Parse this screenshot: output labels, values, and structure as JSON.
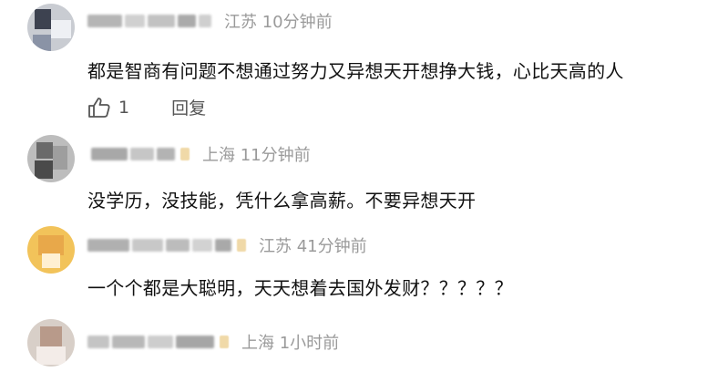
{
  "comments": [
    {
      "location_time": "江苏 10分钟前",
      "text": "都是智商有问题不想通过努力又异想天开想挣大钱，心比天高的人",
      "like_count": "1",
      "reply_label": "回复"
    },
    {
      "location_time": "上海 11分钟前",
      "text": "没学历，没技能，凭什么拿高薪。不要异想天开"
    },
    {
      "location_time": "江苏 41分钟前",
      "text": "一个个都是大聪明，天天想着去国外发财？？？？？"
    },
    {
      "location_time": "上海 1小时前"
    }
  ]
}
